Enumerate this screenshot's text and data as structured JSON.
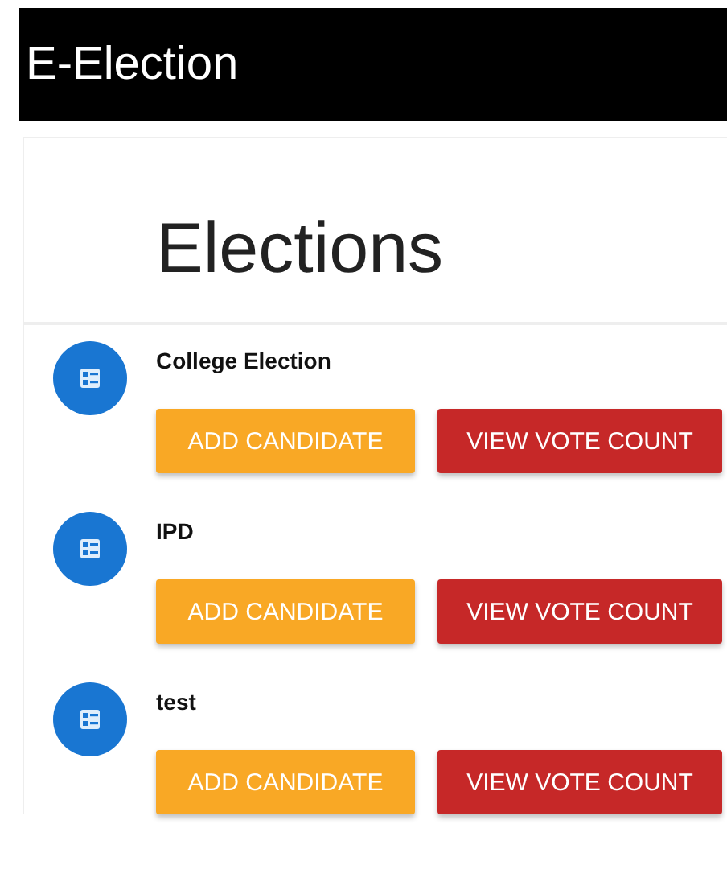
{
  "app_bar": {
    "title": "E-Election"
  },
  "page": {
    "heading": "Elections"
  },
  "elections": [
    {
      "name": "College Election",
      "buttons": [
        "ADD CANDIDATE",
        "VIEW VOTE COUNT"
      ]
    },
    {
      "name": "IPD",
      "buttons": [
        "ADD CANDIDATE",
        "VIEW VOTE COUNT"
      ]
    },
    {
      "name": "test",
      "buttons": [
        "ADD CANDIDATE",
        "VIEW VOTE COUNT"
      ]
    }
  ]
}
